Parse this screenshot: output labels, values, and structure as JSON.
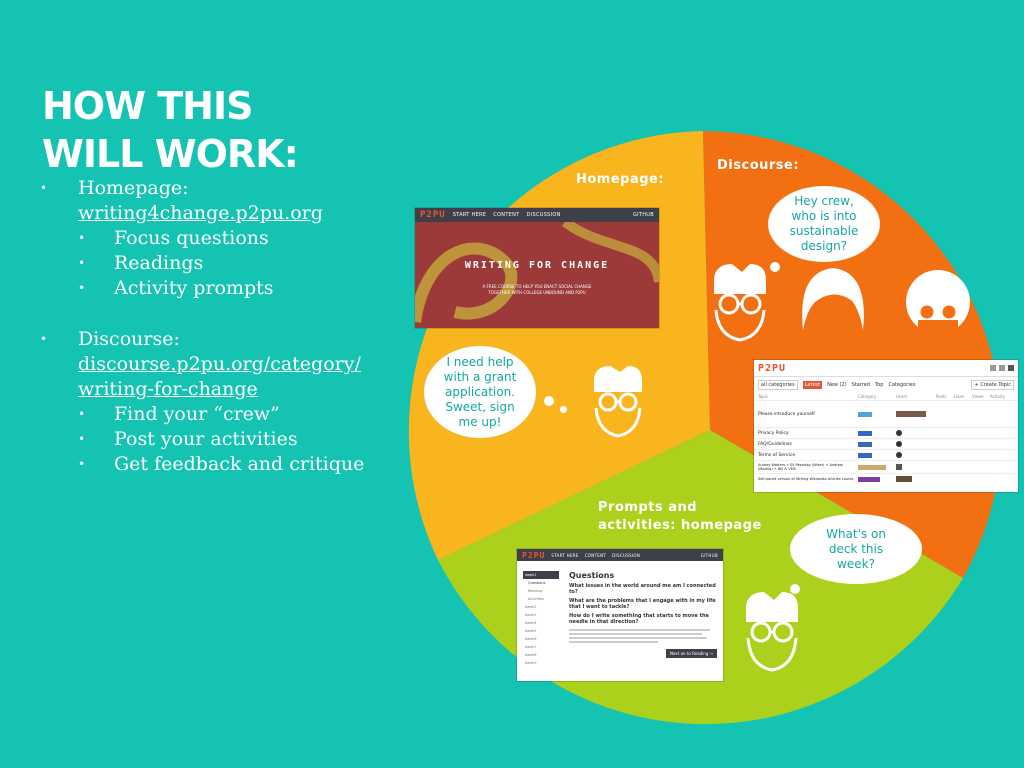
{
  "slide": {
    "title_lines": [
      "HOW THIS",
      "WILL WORK:"
    ]
  },
  "bullets": {
    "homepage": {
      "label": "Homepage:",
      "link": "writing4change.p2pu.org",
      "items": [
        "Focus questions",
        "Readings",
        "Activity prompts"
      ]
    },
    "discourse": {
      "label": "Discourse:",
      "link_lines": [
        "discourse.p2pu.org/category/",
        "writing-for-change"
      ],
      "items": [
        "Find your “crew”",
        "Post your activities",
        "Get feedback and critique"
      ]
    }
  },
  "wheel": {
    "colors": {
      "homepage": "#f9b51e",
      "discourse": "#f26f12",
      "prompts": "#acd11d",
      "background": "#14c3b1"
    },
    "segments": {
      "homepage": "Homepage:",
      "discourse": "Discourse:",
      "prompts_lines": [
        "Prompts and",
        "activities: homepage"
      ]
    }
  },
  "clouds": {
    "crew": [
      "Hey crew,",
      "who is into",
      "sustainable",
      "design?"
    ],
    "help": [
      "I need help",
      "with a grant",
      "application.",
      "Sweet, sign",
      "me up!"
    ],
    "deck": [
      "What's on",
      "deck this",
      "week?"
    ]
  },
  "screens": {
    "homepage": {
      "logo": "P2PU",
      "nav": [
        "START HERE",
        "CONTENT",
        "DISCUSSION"
      ],
      "nav_right": "GITHUB",
      "hero_title": "WRITING FOR CHANGE",
      "hero_sub_lines": [
        "A FREE COURSE TO HELP YOU ENACT SOCIAL CHANGE",
        "TOGETHER WITH COLLEGE UNBOUND AND P2PU"
      ]
    },
    "forum": {
      "logo": "P2PU",
      "filters": [
        "all categories",
        "Latest",
        "New (2)",
        "Starred",
        "Top",
        "Categories"
      ],
      "create_button": "+ Create Topic",
      "columns": [
        "Topic",
        "Category",
        "Users",
        "Posts",
        "Likes",
        "Views",
        "Activity"
      ],
      "topics": [
        "Please introduce yourself",
        "Privacy Policy",
        "FAQ/Guidelines",
        "Terms of Service",
        "Audrey Watters + Eli Pesetsky (Wiser) + Andrew (Mozilla) + Bill & VMS",
        "Self-paced version of Writing Wikipedia Articles course"
      ]
    },
    "prompts": {
      "logo": "P2PU",
      "nav": [
        "START HERE",
        "CONTENT",
        "DISCUSSION"
      ],
      "nav_right": "GITHUB",
      "sidebar": [
        "week1",
        "Questions",
        "Reading",
        "Activities",
        "week2",
        "week3",
        "week4",
        "week5",
        "week6",
        "week7",
        "week8",
        "week9"
      ],
      "heading": "Questions",
      "questions": [
        "What issues in the world around me am I connected to?",
        "What are the problems that I engage with in my life that I want to tackle?",
        "How do I write something that starts to move the needle in that direction?"
      ],
      "button": "Next on to Reading →"
    }
  }
}
